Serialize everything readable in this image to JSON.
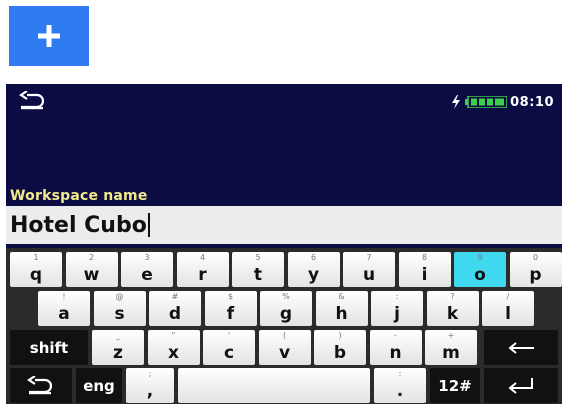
{
  "toolbar": {
    "add_icon": "plus-icon",
    "accent": "#2f7cf0"
  },
  "status_bar": {
    "back_icon": "back-arrow-icon",
    "power_icon": "plug-icon",
    "battery_icon": "battery-icon",
    "time": "08:10"
  },
  "form": {
    "label": "Workspace name",
    "value": "Hotel Cubo"
  },
  "keyboard": {
    "row1": [
      {
        "sym": "1",
        "ch": "q"
      },
      {
        "sym": "2",
        "ch": "w"
      },
      {
        "sym": "3",
        "ch": "e"
      },
      {
        "sym": "4",
        "ch": "r"
      },
      {
        "sym": "5",
        "ch": "t"
      },
      {
        "sym": "6",
        "ch": "y"
      },
      {
        "sym": "7",
        "ch": "u"
      },
      {
        "sym": "8",
        "ch": "i"
      },
      {
        "sym": "9",
        "ch": "o"
      },
      {
        "sym": "0",
        "ch": "p"
      }
    ],
    "row2": [
      {
        "sym": "!",
        "ch": "a"
      },
      {
        "sym": "@",
        "ch": "s"
      },
      {
        "sym": "#",
        "ch": "d"
      },
      {
        "sym": "$",
        "ch": "f"
      },
      {
        "sym": "%",
        "ch": "g"
      },
      {
        "sym": "&",
        "ch": "h"
      },
      {
        "sym": ":",
        "ch": "j"
      },
      {
        "sym": "?",
        "ch": "k"
      },
      {
        "sym": "/",
        "ch": "l"
      }
    ],
    "row3": [
      {
        "sym": "_",
        "ch": "z"
      },
      {
        "sym": "\"",
        "ch": "x"
      },
      {
        "sym": "'",
        "ch": "c"
      },
      {
        "sym": "(",
        "ch": "v"
      },
      {
        "sym": ")",
        "ch": "b"
      },
      {
        "sym": "-",
        "ch": "n"
      },
      {
        "sym": "+",
        "ch": "m"
      }
    ],
    "shift_label": "shift",
    "lang_label": "eng",
    "comma": {
      "sym": ";",
      "ch": ","
    },
    "period": {
      "sym": ":",
      "ch": "."
    },
    "numbers_label": "12#",
    "backspace_icon": "backspace-arrow-icon",
    "enter_icon": "enter-icon",
    "exit_icon": "back-arrow-icon",
    "active_key": "o",
    "active_color": "#40d8ee"
  }
}
